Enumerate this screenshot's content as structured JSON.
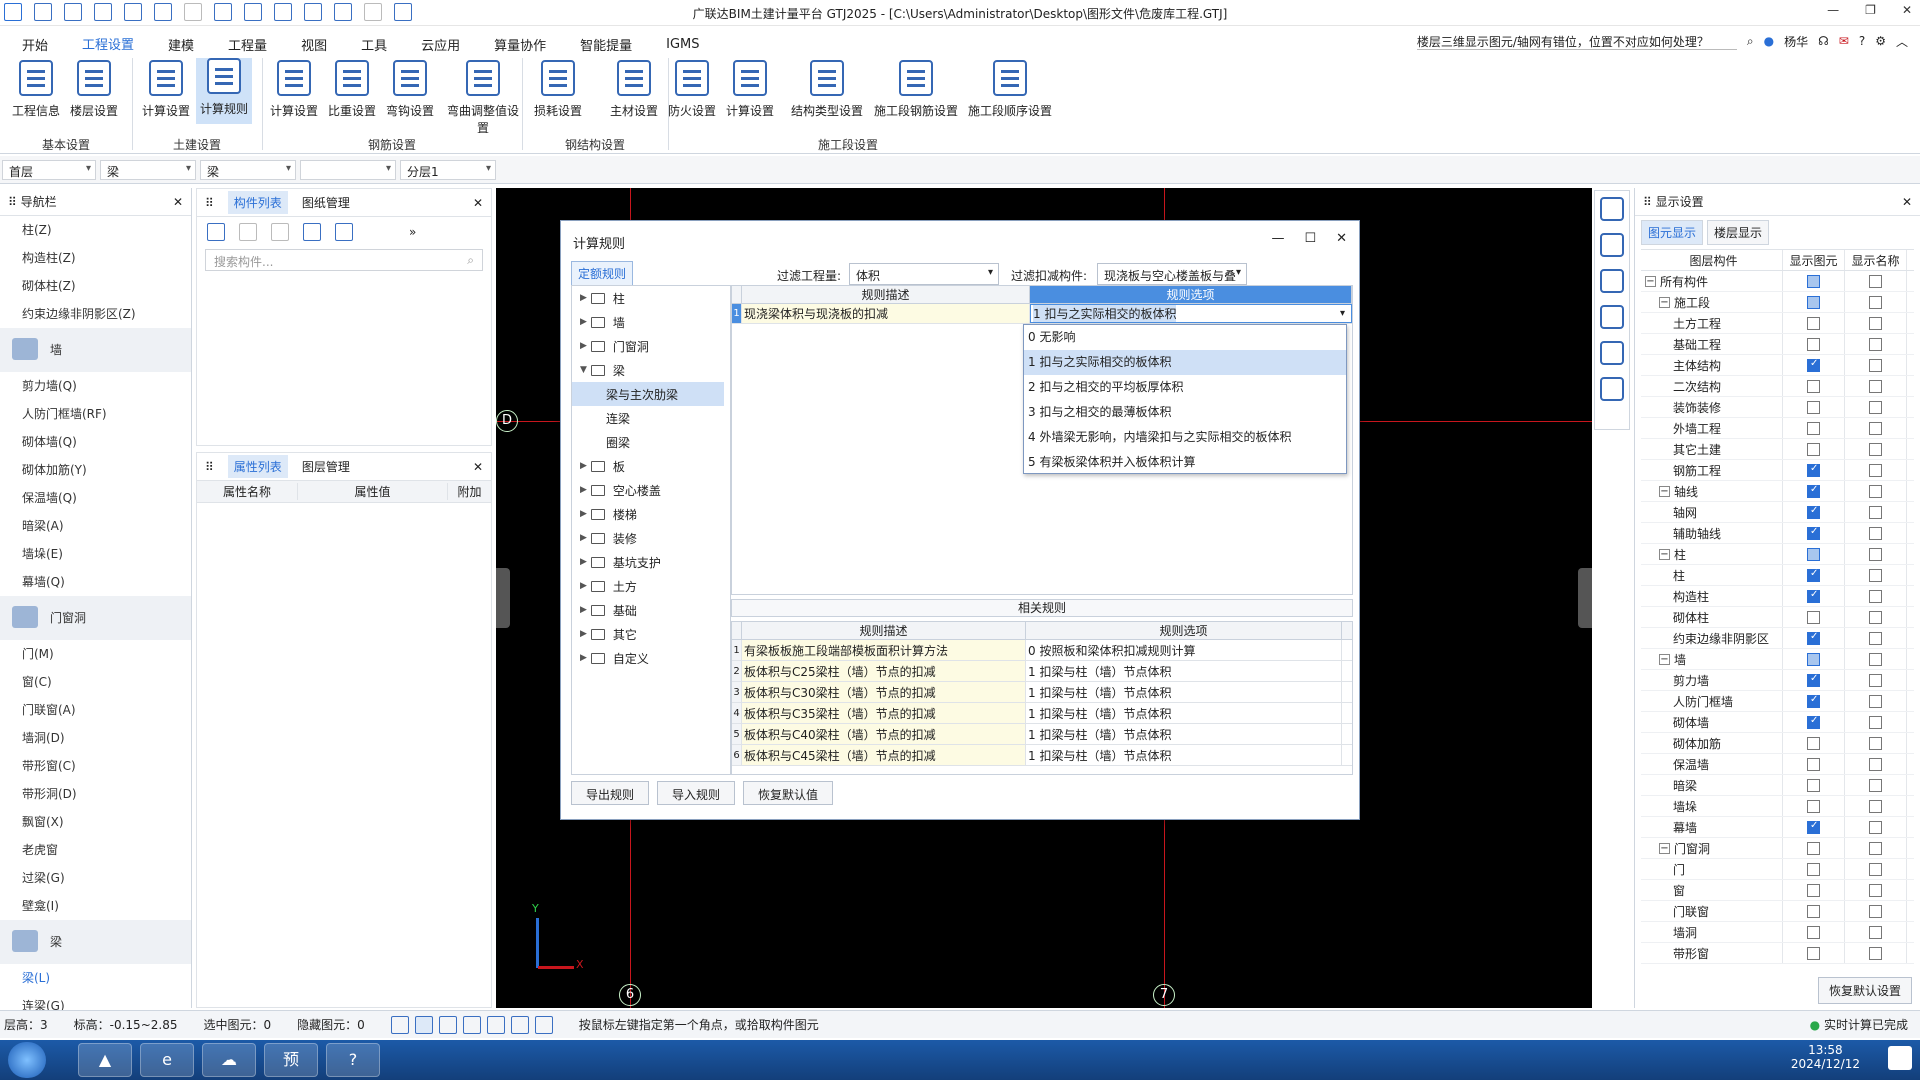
{
  "window": {
    "title": "广联达BIM土建计量平台 GTJ2025 - [C:\\Users\\Administrator\\Desktop\\图形文件\\危废库工程.GTJ]"
  },
  "menu": [
    "开始",
    "工程设置",
    "建模",
    "工程量",
    "视图",
    "工具",
    "云应用",
    "算量协作",
    "智能提量",
    "IGMS"
  ],
  "help": {
    "question": "楼层三维显示图元/轴网有错位，位置不对应如何处理？",
    "user": "杨华"
  },
  "ribbon": {
    "buttons": [
      "工程信息",
      "楼层设置",
      "计算设置",
      "计算规则",
      "计算设置",
      "比重设置",
      "弯钩设置",
      "弯曲调整值设置",
      "损耗设置",
      "主材设置",
      "防火设置",
      "计算设置",
      "结构类型设置",
      "施工段钢筋设置",
      "施工段顺序设置"
    ],
    "groups": [
      "基本设置",
      "土建设置",
      "钢筋设置",
      "钢结构设置",
      "施工段设置"
    ]
  },
  "selectors": [
    "首层",
    "梁",
    "梁",
    "",
    "分层1"
  ],
  "nav": {
    "title": "导航栏",
    "items": [
      {
        "t": "柱(Z)",
        "k": "item"
      },
      {
        "t": "构造柱(Z)",
        "k": "item"
      },
      {
        "t": "砌体柱(Z)",
        "k": "item"
      },
      {
        "t": "约束边缘非阴影区(Z)",
        "k": "item"
      },
      {
        "t": "墙",
        "k": "cat"
      },
      {
        "t": "剪力墙(Q)",
        "k": "item"
      },
      {
        "t": "人防门框墙(RF)",
        "k": "item"
      },
      {
        "t": "砌体墙(Q)",
        "k": "item"
      },
      {
        "t": "砌体加筋(Y)",
        "k": "item"
      },
      {
        "t": "保温墙(Q)",
        "k": "item"
      },
      {
        "t": "暗梁(A)",
        "k": "item"
      },
      {
        "t": "墙垛(E)",
        "k": "item"
      },
      {
        "t": "幕墙(Q)",
        "k": "item"
      },
      {
        "t": "门窗洞",
        "k": "cat"
      },
      {
        "t": "门(M)",
        "k": "item"
      },
      {
        "t": "窗(C)",
        "k": "item"
      },
      {
        "t": "门联窗(A)",
        "k": "item"
      },
      {
        "t": "墙洞(D)",
        "k": "item"
      },
      {
        "t": "带形窗(C)",
        "k": "item"
      },
      {
        "t": "带形洞(D)",
        "k": "item"
      },
      {
        "t": "飘窗(X)",
        "k": "item"
      },
      {
        "t": "老虎窗",
        "k": "item"
      },
      {
        "t": "过梁(G)",
        "k": "item"
      },
      {
        "t": "壁龛(I)",
        "k": "item"
      },
      {
        "t": "梁",
        "k": "cat"
      },
      {
        "t": "梁(L)",
        "k": "hl"
      },
      {
        "t": "连梁(G)",
        "k": "item"
      }
    ]
  },
  "complist": {
    "tabs": [
      "构件列表",
      "图纸管理"
    ],
    "search": "搜索构件..."
  },
  "props": {
    "tabs": [
      "属性列表",
      "图层管理"
    ],
    "cols": [
      "属性名称",
      "属性值",
      "附加"
    ]
  },
  "canvas": {
    "axes": {
      "top": "D",
      "b1": "6",
      "b2": "7"
    },
    "ucs": {
      "x": "X",
      "y": "Y"
    }
  },
  "display": {
    "title": "显示设置",
    "tabs": [
      "图元显示",
      "楼层显示"
    ],
    "cols": [
      "图层构件",
      "显示图元",
      "显示名称"
    ],
    "rows": [
      {
        "n": "所有构件",
        "l": 0,
        "t": "-",
        "a": "part",
        "b": ""
      },
      {
        "n": "施工段",
        "l": 1,
        "t": "-",
        "a": "part",
        "b": ""
      },
      {
        "n": "土方工程",
        "l": 2,
        "a": "",
        "b": ""
      },
      {
        "n": "基础工程",
        "l": 2,
        "a": "",
        "b": ""
      },
      {
        "n": "主体结构",
        "l": 2,
        "a": "on",
        "b": ""
      },
      {
        "n": "二次结构",
        "l": 2,
        "a": "",
        "b": ""
      },
      {
        "n": "装饰装修",
        "l": 2,
        "a": "",
        "b": ""
      },
      {
        "n": "外墙工程",
        "l": 2,
        "a": "",
        "b": ""
      },
      {
        "n": "其它土建",
        "l": 2,
        "a": "",
        "b": ""
      },
      {
        "n": "钢筋工程",
        "l": 2,
        "a": "on",
        "b": ""
      },
      {
        "n": "轴线",
        "l": 1,
        "t": "-",
        "a": "on",
        "b": ""
      },
      {
        "n": "轴网",
        "l": 2,
        "a": "on",
        "b": ""
      },
      {
        "n": "辅助轴线",
        "l": 2,
        "a": "on",
        "b": ""
      },
      {
        "n": "柱",
        "l": 1,
        "t": "-",
        "a": "part",
        "b": ""
      },
      {
        "n": "柱",
        "l": 2,
        "a": "on",
        "b": ""
      },
      {
        "n": "构造柱",
        "l": 2,
        "a": "on",
        "b": ""
      },
      {
        "n": "砌体柱",
        "l": 2,
        "a": "",
        "b": ""
      },
      {
        "n": "约束边缘非阴影区",
        "l": 2,
        "a": "on",
        "b": ""
      },
      {
        "n": "墙",
        "l": 1,
        "t": "-",
        "a": "part",
        "b": ""
      },
      {
        "n": "剪力墙",
        "l": 2,
        "a": "on",
        "b": ""
      },
      {
        "n": "人防门框墙",
        "l": 2,
        "a": "on",
        "b": ""
      },
      {
        "n": "砌体墙",
        "l": 2,
        "a": "on",
        "b": ""
      },
      {
        "n": "砌体加筋",
        "l": 2,
        "a": "",
        "b": ""
      },
      {
        "n": "保温墙",
        "l": 2,
        "a": "",
        "b": ""
      },
      {
        "n": "暗梁",
        "l": 2,
        "a": "",
        "b": ""
      },
      {
        "n": "墙垛",
        "l": 2,
        "a": "",
        "b": ""
      },
      {
        "n": "幕墙",
        "l": 2,
        "a": "on",
        "b": ""
      },
      {
        "n": "门窗洞",
        "l": 1,
        "t": "-",
        "a": "",
        "b": ""
      },
      {
        "n": "门",
        "l": 2,
        "a": "",
        "b": ""
      },
      {
        "n": "窗",
        "l": 2,
        "a": "",
        "b": ""
      },
      {
        "n": "门联窗",
        "l": 2,
        "a": "",
        "b": ""
      },
      {
        "n": "墙洞",
        "l": 2,
        "a": "",
        "b": ""
      },
      {
        "n": "带形窗",
        "l": 2,
        "a": "",
        "b": ""
      }
    ],
    "reset": "恢复默认设置"
  },
  "dialog": {
    "title": "计算规则",
    "tab": "定额规则",
    "filter_qty_label": "过滤工程量:",
    "filter_qty": "体积",
    "filter_deduct_label": "过滤扣减构件:",
    "filter_deduct": "现浇板与空心楼盖板与叠",
    "tree": [
      {
        "t": "柱",
        "l": 0,
        "f": true
      },
      {
        "t": "墙",
        "l": 0,
        "f": true
      },
      {
        "t": "门窗洞",
        "l": 0,
        "f": true
      },
      {
        "t": "梁",
        "l": 0,
        "f": true,
        "open": true
      },
      {
        "t": "梁与主次肋梁",
        "l": 1,
        "sel": true
      },
      {
        "t": "连梁",
        "l": 1
      },
      {
        "t": "圈梁",
        "l": 1
      },
      {
        "t": "板",
        "l": 0,
        "f": true
      },
      {
        "t": "空心楼盖",
        "l": 0,
        "f": true
      },
      {
        "t": "楼梯",
        "l": 0,
        "f": true
      },
      {
        "t": "装修",
        "l": 0,
        "f": true
      },
      {
        "t": "基坑支护",
        "l": 0,
        "f": true
      },
      {
        "t": "土方",
        "l": 0,
        "f": true
      },
      {
        "t": "基础",
        "l": 0,
        "f": true
      },
      {
        "t": "其它",
        "l": 0,
        "f": true
      },
      {
        "t": "自定义",
        "l": 0,
        "f": true
      }
    ],
    "grid_cols": [
      "规则描述",
      "规则选项"
    ],
    "grid_rows": [
      {
        "n": "1",
        "d": "现浇梁体积与现浇板的扣减",
        "o": "1 扣与之实际相交的板体积"
      }
    ],
    "dropdown": [
      "0  无影响",
      "1 扣与之实际相交的板体积",
      "2 扣与之相交的平均板厚体积",
      "3 扣与之相交的最薄板体积",
      "4 外墙梁无影响，内墙梁扣与之实际相交的板体积",
      "5 有梁板梁体积并入板体积计算"
    ],
    "related_title": "相关规则",
    "rel_rows": [
      {
        "n": "1",
        "d": "有梁板板施工段端部模板面积计算方法",
        "o": "0  按照板和梁体积扣减规则计算"
      },
      {
        "n": "2",
        "d": "板体积与C25梁柱（墙）节点的扣减",
        "o": "1  扣梁与柱（墙）节点体积"
      },
      {
        "n": "3",
        "d": "板体积与C30梁柱（墙）节点的扣减",
        "o": "1  扣梁与柱（墙）节点体积"
      },
      {
        "n": "4",
        "d": "板体积与C35梁柱（墙）节点的扣减",
        "o": "1  扣梁与柱（墙）节点体积"
      },
      {
        "n": "5",
        "d": "板体积与C40梁柱（墙）节点的扣减",
        "o": "1  扣梁与柱（墙）节点体积"
      },
      {
        "n": "6",
        "d": "板体积与C45梁柱（墙）节点的扣减",
        "o": "1  扣梁与柱（墙）节点体积"
      }
    ],
    "buttons": [
      "导出规则",
      "导入规则",
      "恢复默认值"
    ]
  },
  "status": {
    "floor": "层高：3",
    "elev": "标高：-0.15~2.85",
    "selected": "选中图元：0",
    "hidden": "隐藏图元：0",
    "hint": "按鼠标左键指定第一个角点，或拾取构件图元",
    "calc": "实时计算已完成"
  },
  "taskbar": {
    "apps": [
      "e",
      "预",
      "?"
    ],
    "time": "13:58",
    "date": "2024/12/12"
  },
  "colors": {
    "accent": "#2a6fd6",
    "canvas": "#000000",
    "gridline": "#c8161d"
  }
}
